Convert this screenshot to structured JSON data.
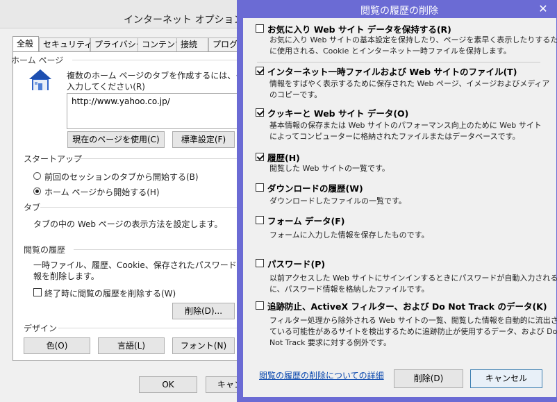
{
  "internet_options": {
    "title": "インターネット オプション",
    "tabs": [
      "全般",
      "セキュリティ",
      "プライバシー",
      "コンテンツ",
      "接続",
      "プログラ"
    ],
    "home_page": {
      "section_label": "ホーム ページ",
      "description_line1": "複数のホーム ページのタブを作成するには、それぞ",
      "description_line2": "入力してください(R)",
      "url": "http://www.yahoo.co.jp/",
      "use_current_button": "現在のページを使用(C)",
      "use_default_button": "標準設定(F)"
    },
    "startup": {
      "section_label": "スタートアップ",
      "option_previous": "前回のセッションのタブから開始する(B)",
      "option_home": "ホーム ページから開始する(H)"
    },
    "tabs_section": {
      "section_label": "タブ",
      "description": "タブの中の Web ページの表示方法を設定します。"
    },
    "browsing_history": {
      "section_label": "閲覧の履歴",
      "description_line1": "一時ファイル、履歴、Cookie、保存されたパスワード、および",
      "description_line2": "報を削除します。",
      "delete_on_exit": "終了時に閲覧の履歴を削除する(W)",
      "delete_button": "削除(D)..."
    },
    "appearance": {
      "section_label": "デザイン",
      "colors_button": "色(O)",
      "languages_button": "言語(L)",
      "fonts_button": "フォント(N)"
    },
    "ok_button": "OK",
    "cancel_button": "キャン"
  },
  "delete_history": {
    "title": "閲覧の履歴の削除",
    "close_glyph": "✕",
    "options": [
      {
        "label": "お気に入り Web サイト データを保持する(R)",
        "checked": false,
        "desc": [
          "お気に入り Web サイトの基本設定を保持したり、ページを素早く表示したりするため",
          "に使用される、Cookie とインターネット一時ファイルを保持します。"
        ]
      },
      {
        "label": "インターネット一時ファイルおよび Web サイトのファイル(T)",
        "checked": true,
        "desc": [
          "情報をすばやく表示するために保存された Web ページ、イメージおよびメディア",
          "のコピーです。"
        ]
      },
      {
        "label": "クッキーと Web サイト データ(O)",
        "checked": true,
        "desc": [
          "基本情報の保存または Web サイトのパフォーマンス向上のために Web サイト",
          "によってコンピューターに格納されたファイルまたはデータベースです。"
        ]
      },
      {
        "label": "履歴(H)",
        "checked": true,
        "desc": [
          "閲覧した Web サイトの一覧です。"
        ]
      },
      {
        "label": "ダウンロードの履歴(W)",
        "checked": false,
        "desc": [
          "ダウンロードしたファイルの一覧です。"
        ]
      },
      {
        "label": "フォーム データ(F)",
        "checked": false,
        "desc": [
          "フォームに入力した情報を保存したものです。"
        ]
      },
      {
        "label": "パスワード(P)",
        "checked": false,
        "desc": [
          "以前アクセスした Web サイトにサインインするときにパスワードが自動入力されるよう",
          "に、パスワード情報を格納したファイルです。"
        ]
      },
      {
        "label": "追跡防止、ActiveX フィルター、および Do Not Track のデータ(K)",
        "checked": false,
        "desc": [
          "フィルター処理から除外される Web サイトの一覧、閲覧した情報を自動的に流出させ",
          "ている可能性があるサイトを検出するために追跡防止が使用するデータ、および Do",
          "Not Track 要求に対する例外です。"
        ]
      }
    ],
    "about_link": "閲覧の履歴の削除についての詳細",
    "delete_button": "削除(D)",
    "cancel_button": "キャンセル"
  },
  "colors": {
    "dialog_frame": "#6b6bd4",
    "link": "#0645ad"
  }
}
